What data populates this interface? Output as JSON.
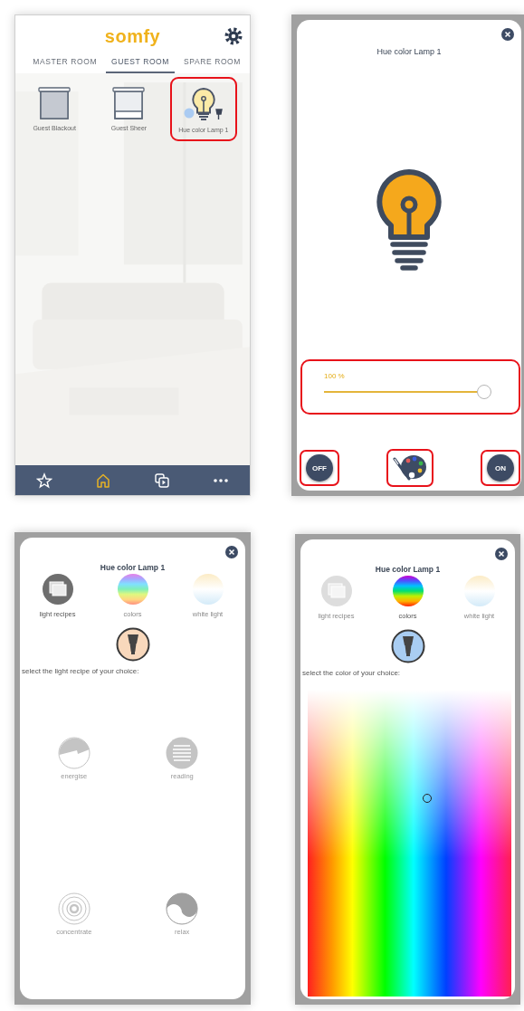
{
  "screens": [
    {
      "kind": "rooms",
      "logo": "somfy",
      "tabs": [
        {
          "label": "MASTER ROOM",
          "selected": false
        },
        {
          "label": "GUEST ROOM",
          "selected": true
        },
        {
          "label": "SPARE ROOM",
          "selected": false
        }
      ],
      "devices": [
        {
          "label": "Guest Blackout",
          "kind": "blind-dark",
          "highlighted": false
        },
        {
          "label": "Guest Sheer",
          "kind": "blind-sheer",
          "highlighted": false
        },
        {
          "label": "Hue color Lamp 1",
          "kind": "lamp",
          "highlighted": true
        }
      ],
      "nav": [
        {
          "kind": "favorites",
          "selected": false
        },
        {
          "kind": "home",
          "selected": true
        },
        {
          "kind": "scenes",
          "selected": false
        },
        {
          "kind": "more",
          "selected": false
        }
      ]
    },
    {
      "kind": "dimmer",
      "title": "Hue color Lamp 1",
      "slider": {
        "reading": "100 %",
        "level": 1,
        "highlighted": true
      },
      "buttons": [
        {
          "kind": "off",
          "label": "OFF",
          "highlighted": true
        },
        {
          "kind": "palette",
          "highlighted": true
        },
        {
          "kind": "on",
          "label": "ON",
          "highlighted": true
        }
      ]
    },
    {
      "kind": "recipes",
      "title": "Hue color Lamp 1",
      "modes": [
        {
          "kind": "recipes",
          "label": "light recipes",
          "selected": true
        },
        {
          "kind": "colors",
          "label": "colors",
          "selected": false
        },
        {
          "kind": "white",
          "label": "white light",
          "selected": false
        }
      ],
      "preview": {
        "color": "#f8d8bc"
      },
      "prompt": "select the light recipe of your choice:",
      "recipes": [
        {
          "kind": "energise",
          "label": "energise"
        },
        {
          "kind": "reading",
          "label": "reading"
        },
        {
          "kind": "concentrate",
          "label": "concentrate"
        },
        {
          "kind": "relax",
          "label": "relax"
        }
      ]
    },
    {
      "kind": "color-picker",
      "title": "Hue color Lamp 1",
      "modes": [
        {
          "kind": "recipes",
          "label": "light recipes",
          "selected": false
        },
        {
          "kind": "colors",
          "label": "colors",
          "selected": true
        },
        {
          "kind": "white",
          "label": "white light",
          "selected": false
        }
      ],
      "preview": {
        "color": "#a9cdf2"
      },
      "prompt": "select the color of your choice:"
    }
  ]
}
